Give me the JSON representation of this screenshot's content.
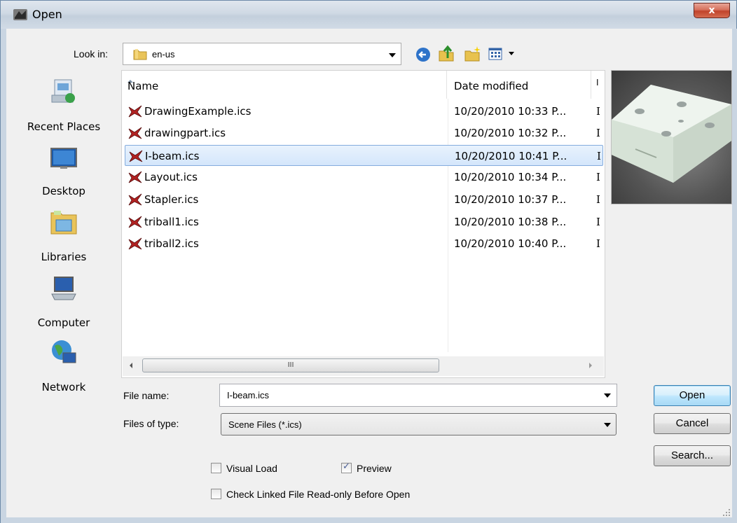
{
  "window": {
    "title": "Open",
    "close_label": "x"
  },
  "toolbar": {
    "look_in_label": "Look in:",
    "look_in_value": "en-us",
    "buttons": [
      "back-icon",
      "up-folder-icon",
      "new-folder-icon",
      "view-menu-icon"
    ]
  },
  "places": [
    {
      "label": "Recent Places",
      "icon": "recent-places-icon"
    },
    {
      "label": "Desktop",
      "icon": "desktop-icon"
    },
    {
      "label": "Libraries",
      "icon": "libraries-icon"
    },
    {
      "label": "Computer",
      "icon": "computer-icon"
    },
    {
      "label": "Network",
      "icon": "network-icon"
    }
  ],
  "file_list": {
    "columns": [
      "Name",
      "Date modified",
      "I"
    ],
    "rows": [
      {
        "name": "DrawingExample.ics",
        "date": "10/20/2010 10:33 P...",
        "more": "I",
        "selected": false
      },
      {
        "name": "drawingpart.ics",
        "date": "10/20/2010 10:32 P...",
        "more": "I",
        "selected": false
      },
      {
        "name": "I-beam.ics",
        "date": "10/20/2010 10:41 P...",
        "more": "I",
        "selected": true
      },
      {
        "name": "Layout.ics",
        "date": "10/20/2010 10:34 P...",
        "more": "I",
        "selected": false
      },
      {
        "name": "Stapler.ics",
        "date": "10/20/2010 10:37 P...",
        "more": "I",
        "selected": false
      },
      {
        "name": "triball1.ics",
        "date": "10/20/2010 10:38 P...",
        "more": "I",
        "selected": false
      },
      {
        "name": "triball2.ics",
        "date": "10/20/2010 10:40 P...",
        "more": "I",
        "selected": false
      }
    ],
    "scroll_thumb_label": "III"
  },
  "form": {
    "file_name_label": "File name:",
    "file_name_value": "I-beam.ics",
    "file_type_label": "Files of type:",
    "file_type_value": "Scene Files (*.ics)"
  },
  "buttons": {
    "open": "Open",
    "cancel": "Cancel",
    "search": "Search..."
  },
  "options": {
    "visual_load_label": "Visual Load",
    "visual_load_checked": false,
    "preview_label": "Preview",
    "preview_checked": true,
    "check_linked_label": "Check Linked File Read-only Before Open",
    "check_linked_checked": false
  },
  "colors": {
    "selection": "#d4e6fb",
    "dialog_bg": "#f0f0f0",
    "close_red": "#c0432b",
    "ics_icon": "#b22222"
  }
}
